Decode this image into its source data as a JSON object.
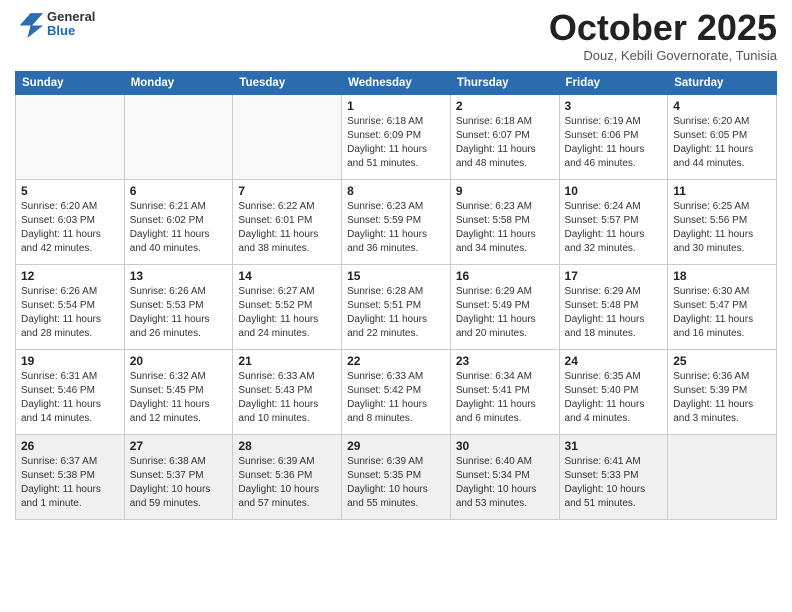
{
  "header": {
    "logo": {
      "line1": "General",
      "line2": "Blue"
    },
    "month_title": "October 2025",
    "location": "Douz, Kebili Governorate, Tunisia"
  },
  "days_of_week": [
    "Sunday",
    "Monday",
    "Tuesday",
    "Wednesday",
    "Thursday",
    "Friday",
    "Saturday"
  ],
  "weeks": [
    [
      {
        "day": "",
        "info": ""
      },
      {
        "day": "",
        "info": ""
      },
      {
        "day": "",
        "info": ""
      },
      {
        "day": "1",
        "info": "Sunrise: 6:18 AM\nSunset: 6:09 PM\nDaylight: 11 hours\nand 51 minutes."
      },
      {
        "day": "2",
        "info": "Sunrise: 6:18 AM\nSunset: 6:07 PM\nDaylight: 11 hours\nand 48 minutes."
      },
      {
        "day": "3",
        "info": "Sunrise: 6:19 AM\nSunset: 6:06 PM\nDaylight: 11 hours\nand 46 minutes."
      },
      {
        "day": "4",
        "info": "Sunrise: 6:20 AM\nSunset: 6:05 PM\nDaylight: 11 hours\nand 44 minutes."
      }
    ],
    [
      {
        "day": "5",
        "info": "Sunrise: 6:20 AM\nSunset: 6:03 PM\nDaylight: 11 hours\nand 42 minutes."
      },
      {
        "day": "6",
        "info": "Sunrise: 6:21 AM\nSunset: 6:02 PM\nDaylight: 11 hours\nand 40 minutes."
      },
      {
        "day": "7",
        "info": "Sunrise: 6:22 AM\nSunset: 6:01 PM\nDaylight: 11 hours\nand 38 minutes."
      },
      {
        "day": "8",
        "info": "Sunrise: 6:23 AM\nSunset: 5:59 PM\nDaylight: 11 hours\nand 36 minutes."
      },
      {
        "day": "9",
        "info": "Sunrise: 6:23 AM\nSunset: 5:58 PM\nDaylight: 11 hours\nand 34 minutes."
      },
      {
        "day": "10",
        "info": "Sunrise: 6:24 AM\nSunset: 5:57 PM\nDaylight: 11 hours\nand 32 minutes."
      },
      {
        "day": "11",
        "info": "Sunrise: 6:25 AM\nSunset: 5:56 PM\nDaylight: 11 hours\nand 30 minutes."
      }
    ],
    [
      {
        "day": "12",
        "info": "Sunrise: 6:26 AM\nSunset: 5:54 PM\nDaylight: 11 hours\nand 28 minutes."
      },
      {
        "day": "13",
        "info": "Sunrise: 6:26 AM\nSunset: 5:53 PM\nDaylight: 11 hours\nand 26 minutes."
      },
      {
        "day": "14",
        "info": "Sunrise: 6:27 AM\nSunset: 5:52 PM\nDaylight: 11 hours\nand 24 minutes."
      },
      {
        "day": "15",
        "info": "Sunrise: 6:28 AM\nSunset: 5:51 PM\nDaylight: 11 hours\nand 22 minutes."
      },
      {
        "day": "16",
        "info": "Sunrise: 6:29 AM\nSunset: 5:49 PM\nDaylight: 11 hours\nand 20 minutes."
      },
      {
        "day": "17",
        "info": "Sunrise: 6:29 AM\nSunset: 5:48 PM\nDaylight: 11 hours\nand 18 minutes."
      },
      {
        "day": "18",
        "info": "Sunrise: 6:30 AM\nSunset: 5:47 PM\nDaylight: 11 hours\nand 16 minutes."
      }
    ],
    [
      {
        "day": "19",
        "info": "Sunrise: 6:31 AM\nSunset: 5:46 PM\nDaylight: 11 hours\nand 14 minutes."
      },
      {
        "day": "20",
        "info": "Sunrise: 6:32 AM\nSunset: 5:45 PM\nDaylight: 11 hours\nand 12 minutes."
      },
      {
        "day": "21",
        "info": "Sunrise: 6:33 AM\nSunset: 5:43 PM\nDaylight: 11 hours\nand 10 minutes."
      },
      {
        "day": "22",
        "info": "Sunrise: 6:33 AM\nSunset: 5:42 PM\nDaylight: 11 hours\nand 8 minutes."
      },
      {
        "day": "23",
        "info": "Sunrise: 6:34 AM\nSunset: 5:41 PM\nDaylight: 11 hours\nand 6 minutes."
      },
      {
        "day": "24",
        "info": "Sunrise: 6:35 AM\nSunset: 5:40 PM\nDaylight: 11 hours\nand 4 minutes."
      },
      {
        "day": "25",
        "info": "Sunrise: 6:36 AM\nSunset: 5:39 PM\nDaylight: 11 hours\nand 3 minutes."
      }
    ],
    [
      {
        "day": "26",
        "info": "Sunrise: 6:37 AM\nSunset: 5:38 PM\nDaylight: 11 hours\nand 1 minute."
      },
      {
        "day": "27",
        "info": "Sunrise: 6:38 AM\nSunset: 5:37 PM\nDaylight: 10 hours\nand 59 minutes."
      },
      {
        "day": "28",
        "info": "Sunrise: 6:39 AM\nSunset: 5:36 PM\nDaylight: 10 hours\nand 57 minutes."
      },
      {
        "day": "29",
        "info": "Sunrise: 6:39 AM\nSunset: 5:35 PM\nDaylight: 10 hours\nand 55 minutes."
      },
      {
        "day": "30",
        "info": "Sunrise: 6:40 AM\nSunset: 5:34 PM\nDaylight: 10 hours\nand 53 minutes."
      },
      {
        "day": "31",
        "info": "Sunrise: 6:41 AM\nSunset: 5:33 PM\nDaylight: 10 hours\nand 51 minutes."
      },
      {
        "day": "",
        "info": ""
      }
    ]
  ]
}
